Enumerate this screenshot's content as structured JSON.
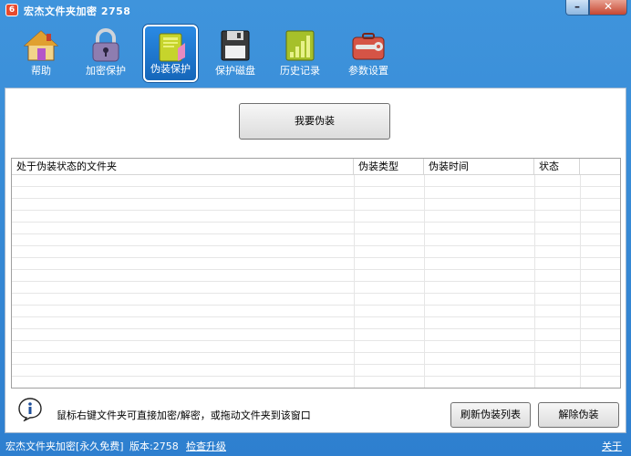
{
  "window": {
    "title": "宏杰文件夹加密  2758",
    "app_icon_glyph": "6",
    "min_glyph": "–",
    "close_glyph": "✕"
  },
  "toolbar": {
    "items": [
      {
        "label": "帮助",
        "icon": "home-icon"
      },
      {
        "label": "加密保护",
        "icon": "lock-icon"
      },
      {
        "label": "伪装保护",
        "icon": "disguise-book-icon",
        "active": true
      },
      {
        "label": "保护磁盘",
        "icon": "floppy-disk-icon"
      },
      {
        "label": "历史记录",
        "icon": "history-chart-icon"
      },
      {
        "label": "参数设置",
        "icon": "toolbox-settings-icon"
      }
    ]
  },
  "main": {
    "disguise_button": "我要伪装",
    "table": {
      "columns": [
        "处于伪装状态的文件夹",
        "伪装类型",
        "伪装时间",
        "状态"
      ],
      "rows": []
    },
    "hint": "鼠标右键文件夹可直接加密/解密，或拖动文件夹到该窗口",
    "refresh_button": "刷新伪装列表",
    "remove_button": "解除伪装"
  },
  "statusbar": {
    "product": "宏杰文件夹加密[永久免费]",
    "version": "版本:2758",
    "check_update": "检查升级",
    "about": "关于"
  },
  "colors": {
    "frame_blue": "#2e7fcf",
    "close_red": "#c74631"
  }
}
